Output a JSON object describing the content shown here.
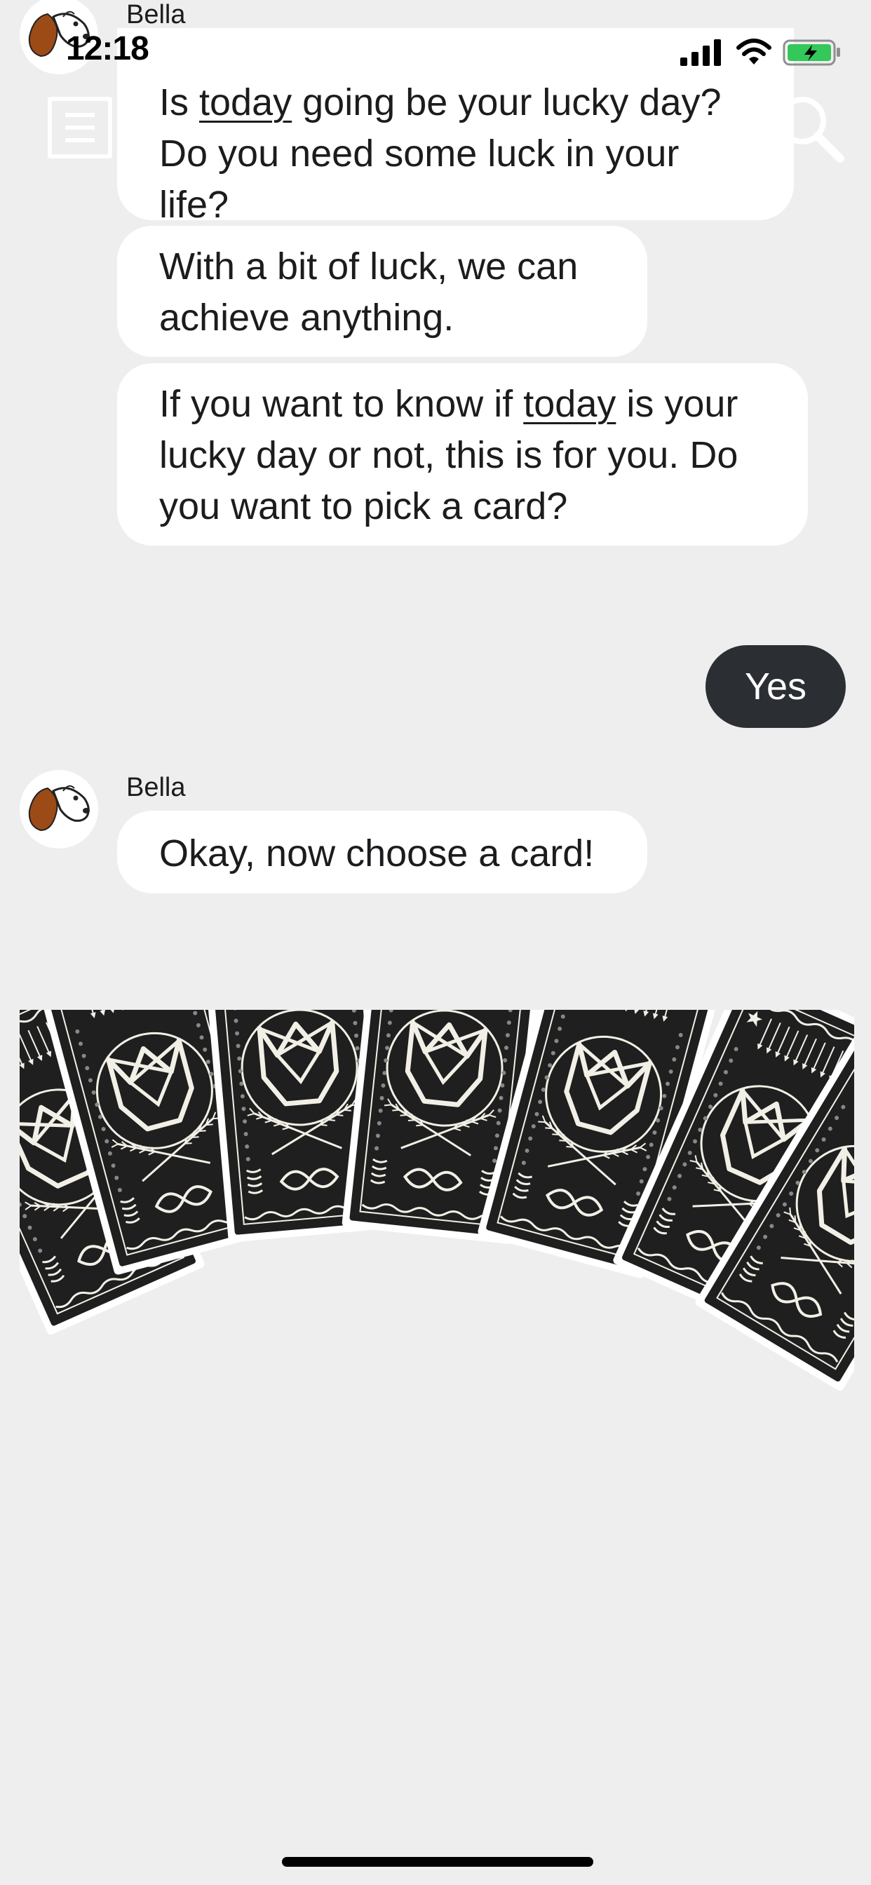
{
  "status_bar": {
    "time": "12:18",
    "battery_color": "#34c759"
  },
  "header": {
    "menu_icon": "menu-icon",
    "search_icon": "search-icon"
  },
  "conversation": {
    "bot_name": "Bella",
    "messages": [
      {
        "from": "Bella",
        "parts": [
          "Is ",
          "today",
          " going be your lucky day? Do you need some luck in your life?"
        ]
      },
      {
        "from": "Bella",
        "text": "With a bit of luck, we can achieve anything."
      },
      {
        "from": "Bella",
        "parts": [
          "If you want to know if ",
          "today",
          " is your lucky day or not, this is for you. Do you want to pick a card?"
        ]
      },
      {
        "from": "user",
        "text": "Yes"
      },
      {
        "from": "Bella",
        "text": "Okay, now choose a card!"
      }
    ]
  },
  "cards": {
    "count": 7,
    "card_color": "#1f1f1f",
    "line_color": "#f2f0e6",
    "border_color": "#ffffff"
  }
}
